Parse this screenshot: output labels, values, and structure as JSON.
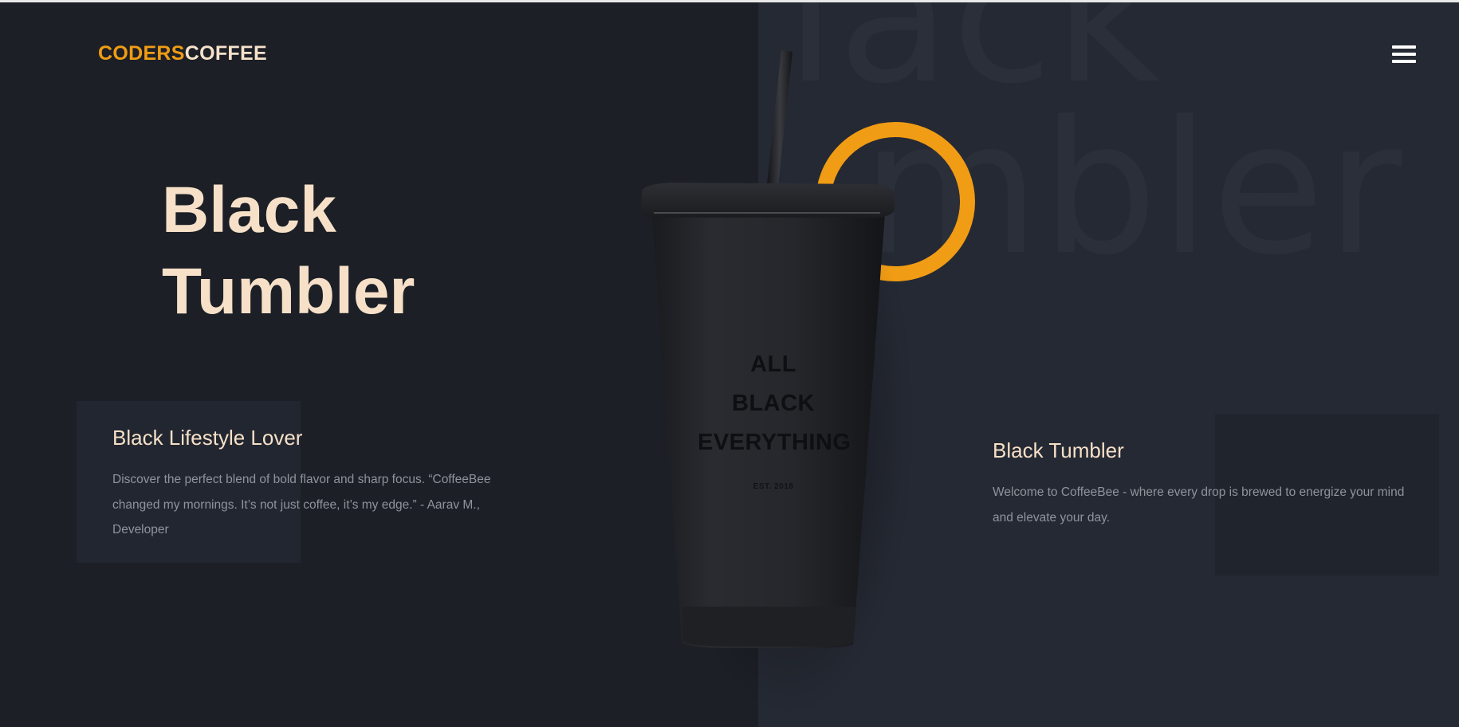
{
  "brand": {
    "part1": "CODERS",
    "part2": "COFFEE",
    "accent_color": "#f09c14",
    "text_color": "#f6e2ca"
  },
  "background": {
    "watermark_line1": "lack",
    "watermark_line2": "mbler"
  },
  "menu": {
    "icon": "hamburger-menu-icon"
  },
  "hero": {
    "title_line1": "Black",
    "title_line2": "Tumbler"
  },
  "left_card": {
    "title": "Black Lifestyle Lover",
    "text": "Discover the perfect blend of bold flavor and sharp focus. “CoffeeBee changed my mornings. It’s not just coffee, it’s my edge.” - Aarav M., Developer"
  },
  "right_card": {
    "title": "Black Tumbler",
    "text": "Welcome to CoffeeBee - where every drop is brewed to energize your mind and elevate your day."
  },
  "product": {
    "label_line1": "ALL",
    "label_line2": "BLACK",
    "label_line3": "EVERYTHING",
    "label_small": "EST. 2018"
  }
}
